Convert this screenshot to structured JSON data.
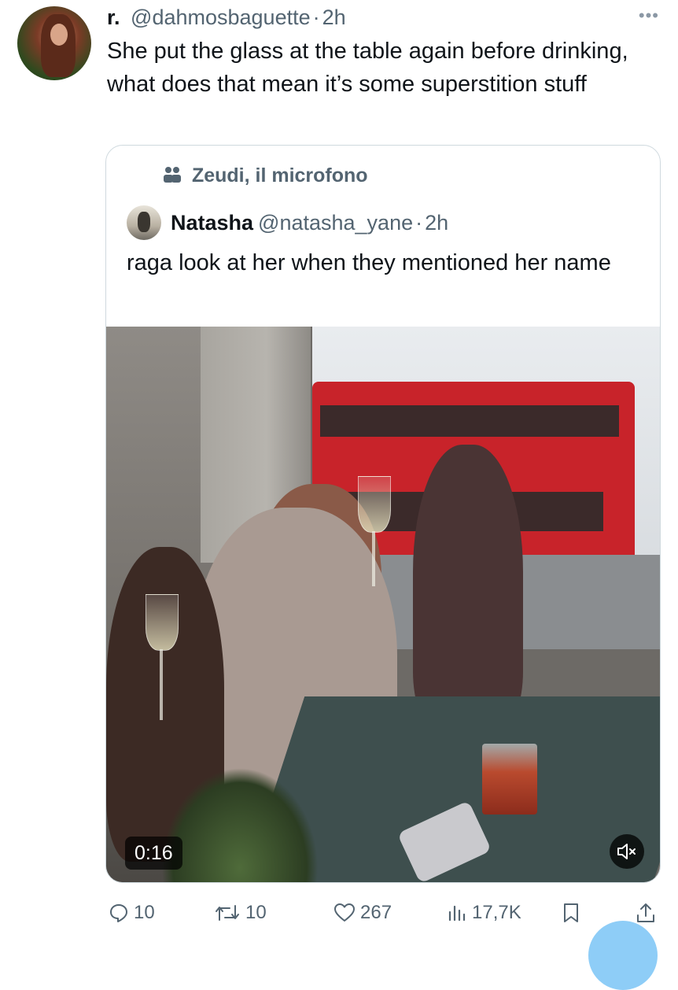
{
  "tweet": {
    "display_name": "r.",
    "handle": "@dahmosbaguette",
    "separator": "·",
    "time": "2h",
    "text": "She put the glass at the table again before drinking, what does that mean it’s some superstition stuff",
    "more_icon": "more-horizontal-icon"
  },
  "quote": {
    "community": "Zeudi, il microfono",
    "display_name": "Natasha",
    "handle": "@natasha_yane",
    "separator": "·",
    "time": "2h",
    "text": "raga look at her when they mentioned her name",
    "video": {
      "duration": "0:16",
      "muted": true
    }
  },
  "actions": {
    "replies": "10",
    "retweets": "10",
    "likes": "267",
    "views": "17,7K"
  },
  "colors": {
    "text": "#0f1419",
    "secondary": "#536471",
    "border": "#cfd9de",
    "fab": "#8ecdf7"
  }
}
